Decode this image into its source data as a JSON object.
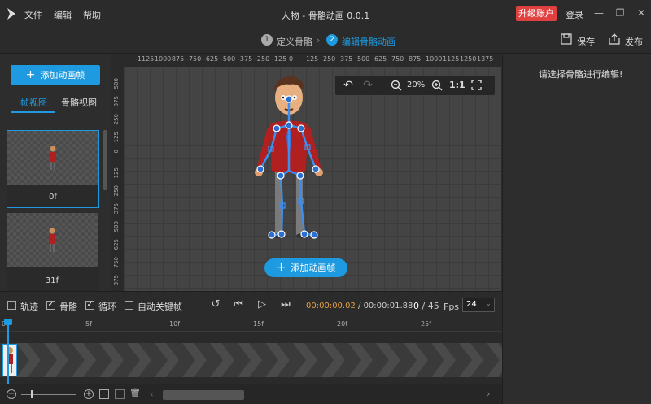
{
  "menu": {
    "file": "文件",
    "edit": "编辑",
    "help": "帮助"
  },
  "window": {
    "title": "人物 - 骨骼动画 0.0.1",
    "upgrade": "升级账户",
    "login": "登录",
    "min_icon": "minimize-icon",
    "max_icon": "restore-icon",
    "close_icon": "close-icon"
  },
  "steps": {
    "step1_num": "1",
    "step1": "定义骨骼",
    "step2_num": "2",
    "step2": "编辑骨骼动画",
    "save": "保存",
    "publish": "发布"
  },
  "left": {
    "add_frame": "添加动画帧",
    "tab_frame": "帧视图",
    "tab_skeleton": "骨骼视图",
    "frames": [
      {
        "label": "0f"
      },
      {
        "label": "31f"
      }
    ]
  },
  "ruler": {
    "top_labels": [
      "-1125",
      "-1000",
      "-875",
      "-750",
      "-625",
      "-500",
      "-375",
      "-250",
      "-125",
      "0",
      "125",
      "250",
      "375",
      "500",
      "625",
      "750",
      "875",
      "1000",
      "1125",
      "1250",
      "1375"
    ],
    "left_labels": [
      "-500",
      "-375",
      "-250",
      "-125",
      "0",
      "125",
      "250",
      "375",
      "500",
      "625",
      "750",
      "875"
    ]
  },
  "zoom": {
    "undo_icon": "undo-icon",
    "redo_icon": "redo-icon",
    "zoom_out_icon": "zoom-out-icon",
    "zoom": "20%",
    "zoom_in_icon": "zoom-in-icon",
    "one_to_one": "1:1",
    "fullscreen_icon": "fullscreen-icon"
  },
  "canvas": {
    "add_frame": "添加动画帧"
  },
  "right": {
    "hint": "请选择骨骼进行编辑!"
  },
  "controls": {
    "trail": "轨迹",
    "bones": "骨骼",
    "loop": "循环",
    "auto_key": "自动关键帧",
    "trail_checked": false,
    "bones_checked": true,
    "loop_checked": true,
    "auto_key_checked": false,
    "current_time": "00:00:00.02",
    "separator": " / ",
    "total_time": "00:00:01.88",
    "frame_current": "0",
    "frame_total": " / 45",
    "fps_label": "Fps",
    "fps_value": "24"
  },
  "timeline": {
    "ticks": [
      "0f",
      "5f",
      "10f",
      "15f",
      "20f",
      "25f"
    ]
  },
  "colors": {
    "accent": "#1e9ae0",
    "upgrade": "#e04040",
    "time_orange": "#e8a040"
  }
}
